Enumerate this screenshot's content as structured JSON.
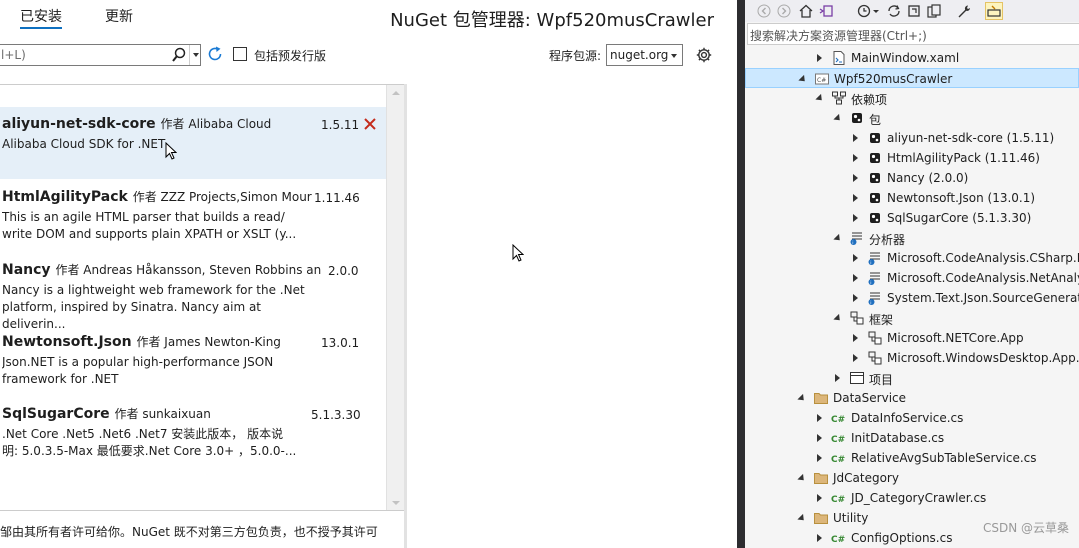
{
  "nuget": {
    "tabs": [
      {
        "label": "已安装",
        "active": true
      },
      {
        "label": "更新",
        "active": false
      }
    ],
    "title": "NuGet 包管理器: Wpf520musCrawler",
    "search": {
      "value": "l+L)"
    },
    "prerelease_label": "包括预发行版",
    "source_label": "程序包源:",
    "source_value": "nuget.org",
    "packages": [
      {
        "name": "aliyun-net-sdk-core",
        "author": "作者 Alibaba Cloud",
        "version": "1.5.11",
        "desc": "Alibaba Cloud SDK for .NET",
        "selected": true
      },
      {
        "name": "HtmlAgilityPack",
        "author": "作者 ZZZ Projects,Simon Mour",
        "version": "1.11.46",
        "desc": "This is an agile HTML parser that builds a read/\nwrite DOM and supports plain XPATH or XSLT (y...",
        "selected": false
      },
      {
        "name": "Nancy",
        "author": "作者 Andreas Håkansson, Steven Robbins an",
        "version": "2.0.0",
        "desc": "Nancy is a lightweight web framework for the .Net\nplatform, inspired by Sinatra. Nancy aim at deliverin...",
        "selected": false
      },
      {
        "name": "Newtonsoft.Json",
        "author": "作者 James Newton-King",
        "version": "13.0.1",
        "desc": "Json.NET is a popular high-performance JSON\nframework for .NET",
        "selected": false
      },
      {
        "name": "SqlSugarCore",
        "author": "作者 sunkaixuan",
        "version": "5.1.3.30",
        "desc": ".Net Core .Net5 .Net6 .Net7 安装此版本，  版本说\n明: 5.0.3.5-Max 最低要求.Net Core 3.0+  ，5.0.0-...",
        "selected": false
      }
    ],
    "footer": "邹由其所有者许可给你。NuGet 既不对第三方包负责，也不授予其许可"
  },
  "solution": {
    "search_placeholder": "搜索解决方案资源管理器(Ctrl+;)",
    "watermark": "CSDN @云草桑",
    "tree": [
      {
        "label": "MainWindow.xaml",
        "icon": "xaml-file-icon",
        "expand": "collapsed"
      },
      {
        "label": "Wpf520musCrawler",
        "icon": "csharp-project-icon",
        "expand": "expanded",
        "selected": true
      },
      {
        "label": "依赖项",
        "icon": "dependencies-icon",
        "expand": "expanded"
      },
      {
        "label": "包",
        "icon": "package-icon",
        "expand": "expanded"
      },
      {
        "label": "aliyun-net-sdk-core (1.5.11)",
        "icon": "package-icon",
        "expand": "collapsed"
      },
      {
        "label": "HtmlAgilityPack (1.11.46)",
        "icon": "package-icon",
        "expand": "collapsed"
      },
      {
        "label": "Nancy (2.0.0)",
        "icon": "package-icon",
        "expand": "collapsed"
      },
      {
        "label": "Newtonsoft.Json (13.0.1)",
        "icon": "package-icon",
        "expand": "collapsed"
      },
      {
        "label": "SqlSugarCore (5.1.3.30)",
        "icon": "package-icon",
        "expand": "collapsed"
      },
      {
        "label": "分析器",
        "icon": "analyzer-icon",
        "expand": "expanded"
      },
      {
        "label": "Microsoft.CodeAnalysis.CSharp.NetA",
        "icon": "analyzer-icon",
        "expand": "collapsed"
      },
      {
        "label": "Microsoft.CodeAnalysis.NetAnalyzer",
        "icon": "analyzer-icon",
        "expand": "collapsed"
      },
      {
        "label": "System.Text.Json.SourceGeneration",
        "icon": "analyzer-icon",
        "expand": "collapsed"
      },
      {
        "label": "框架",
        "icon": "framework-icon",
        "expand": "expanded"
      },
      {
        "label": "Microsoft.NETCore.App",
        "icon": "framework-icon",
        "expand": "collapsed"
      },
      {
        "label": "Microsoft.WindowsDesktop.App.WP",
        "icon": "framework-icon",
        "expand": "collapsed"
      },
      {
        "label": "项目",
        "icon": "project-reference-icon",
        "expand": "collapsed"
      },
      {
        "label": "DataService",
        "icon": "folder-icon",
        "expand": "expanded"
      },
      {
        "label": "DataInfoService.cs",
        "icon": "csharp-file-icon",
        "expand": "collapsed"
      },
      {
        "label": "InitDatabase.cs",
        "icon": "csharp-file-icon",
        "expand": "collapsed"
      },
      {
        "label": "RelativeAvgSubTableService.cs",
        "icon": "csharp-file-icon",
        "expand": "collapsed"
      },
      {
        "label": "JdCategory",
        "icon": "folder-icon",
        "expand": "expanded"
      },
      {
        "label": "JD_CategoryCrawler.cs",
        "icon": "csharp-file-icon",
        "expand": "collapsed"
      },
      {
        "label": "Utility",
        "icon": "folder-icon",
        "expand": "expanded"
      },
      {
        "label": "ConfigOptions.cs",
        "icon": "csharp-file-icon",
        "expand": "collapsed"
      }
    ]
  },
  "colors": {
    "accent": "#0e70c0",
    "selection": "#e5eff8",
    "remove": "#c42b1c",
    "tree_selection": "#cce8ff"
  }
}
